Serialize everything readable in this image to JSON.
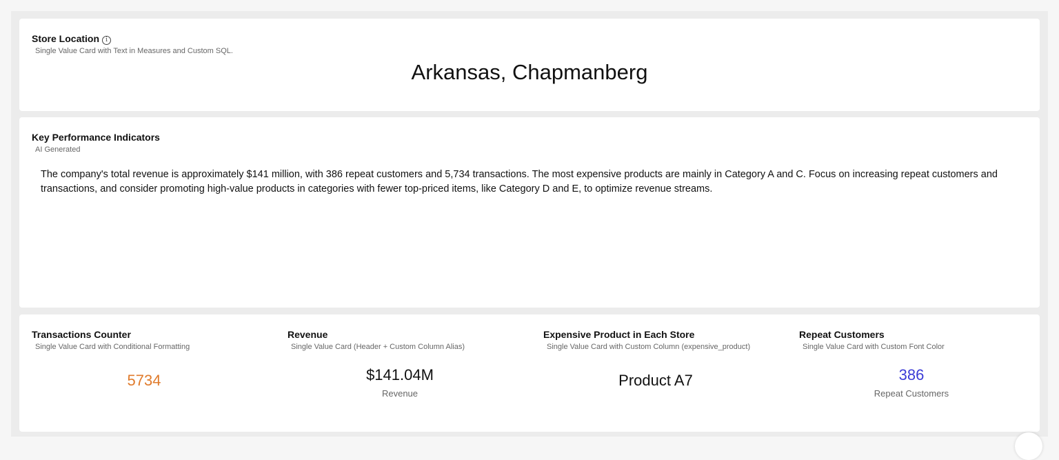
{
  "store_card": {
    "title": "Store Location",
    "subtitle": "Single Value Card with Text in Measures and Custom SQL.",
    "value": "Arkansas, Chapmanberg",
    "info_icon": "info-icon"
  },
  "kpi_card": {
    "title": "Key Performance Indicators",
    "subtitle": "AI Generated",
    "text": "The company's total revenue is approximately $141 million, with 386 repeat customers and 5,734 transactions. The most expensive products are mainly in Category A and C. Focus on increasing repeat customers and transactions, and consider promoting high-value products in categories with fewer top-priced items, like Category D and E, to optimize revenue streams."
  },
  "metrics": [
    {
      "title": "Transactions Counter",
      "subtitle": "Single Value Card with Conditional Formatting",
      "value": "5734",
      "label": "",
      "color": "#e07b2c"
    },
    {
      "title": "Revenue",
      "subtitle": "Single Value Card (Header + Custom Column Alias)",
      "value": "$141.04M",
      "label": "Revenue",
      "color": "#111111"
    },
    {
      "title": "Expensive Product in Each Store",
      "subtitle": "Single Value Card with Custom Column (expensive_product)",
      "value": "Product A7",
      "label": "",
      "color": "#111111"
    },
    {
      "title": "Repeat Customers",
      "subtitle": "Single Value Card with Custom Font Color",
      "value": "386",
      "label": "Repeat Customers",
      "color": "#3b3bd6"
    }
  ]
}
